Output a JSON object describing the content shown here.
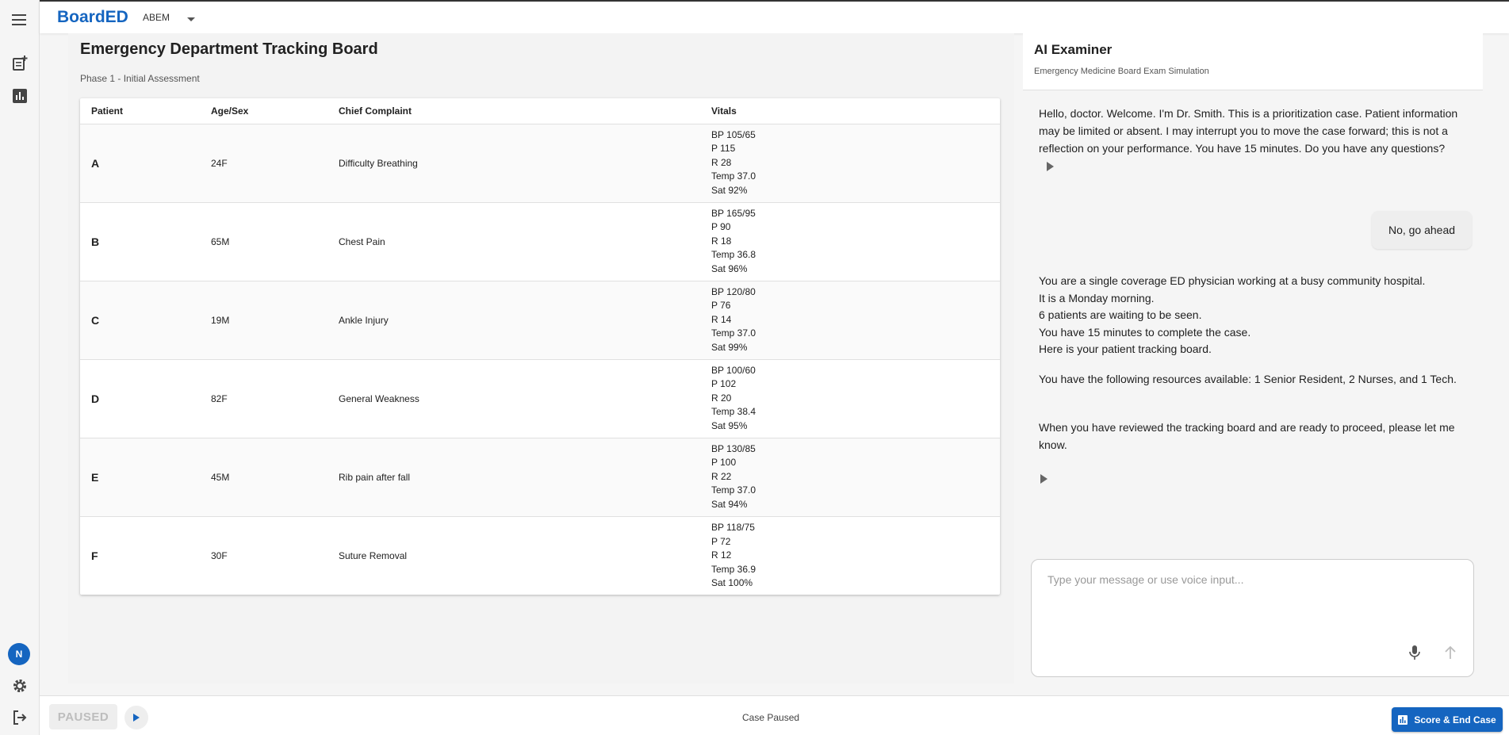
{
  "app": {
    "brand": "BoardED",
    "exam_selector": "ABEM"
  },
  "nav": {
    "icons": [
      "menu-icon",
      "new-case-icon",
      "analytics-icon",
      "settings-icon",
      "logout-icon"
    ],
    "avatar_initial": "N"
  },
  "main": {
    "title": "Emergency Department Tracking Board",
    "phase": "Phase 1 - Initial Assessment",
    "columns": [
      "Patient",
      "Age/Sex",
      "Chief Complaint",
      "Vitals"
    ],
    "patients": [
      {
        "id": "A",
        "age_sex": "24F",
        "complaint": "Difficulty Breathing",
        "bp": "BP 105/65",
        "p": "P 115",
        "r": "R 28",
        "temp": "Temp 37.0",
        "sat": "Sat 92%"
      },
      {
        "id": "B",
        "age_sex": "65M",
        "complaint": "Chest Pain",
        "bp": "BP 165/95",
        "p": "P 90",
        "r": "R 18",
        "temp": "Temp 36.8",
        "sat": "Sat 96%"
      },
      {
        "id": "C",
        "age_sex": "19M",
        "complaint": "Ankle Injury",
        "bp": "BP 120/80",
        "p": "P 76",
        "r": "R 14",
        "temp": "Temp 37.0",
        "sat": "Sat 99%"
      },
      {
        "id": "D",
        "age_sex": "82F",
        "complaint": "General Weakness",
        "bp": "BP 100/60",
        "p": "P 102",
        "r": "R 20",
        "temp": "Temp 38.4",
        "sat": "Sat 95%"
      },
      {
        "id": "E",
        "age_sex": "45M",
        "complaint": "Rib pain after fall",
        "bp": "BP 130/85",
        "p": "P 100",
        "r": "R 22",
        "temp": "Temp 37.0",
        "sat": "Sat 94%"
      },
      {
        "id": "F",
        "age_sex": "30F",
        "complaint": "Suture Removal",
        "bp": "BP 118/75",
        "p": "P 72",
        "r": "R 12",
        "temp": "Temp 36.9",
        "sat": "Sat 100%"
      }
    ]
  },
  "examiner": {
    "title": "AI Examiner",
    "subtitle": "Emergency Medicine Board Exam Simulation",
    "messages": {
      "intro": "Hello, doctor. Welcome. I'm Dr. Smith. This is a prioritization case. Patient information may be limited or absent. I may interrupt you to move the case forward; this is not a reflection on your performance. You have 15 minutes. Do you have any questions?",
      "user_reply": "No, go ahead",
      "scenario_lines": [
        "You are a single coverage ED physician working at a busy community hospital.",
        "It is a Monday morning.",
        "6 patients are waiting to be seen.",
        "You have 15 minutes to complete the case.",
        "Here is your patient tracking board."
      ],
      "resources": "You have the following resources available: 1 Senior Resident, 2 Nurses, and 1 Tech.",
      "proceed": "When you have reviewed the tracking board and are ready to proceed, please let me know."
    },
    "input": {
      "placeholder": "Type your message or use voice input...",
      "value": ""
    }
  },
  "footer": {
    "paused_label": "PAUSED",
    "status": "Case Paused",
    "score_button": "Score & End Case"
  },
  "colors": {
    "brand": "#1565c0",
    "accent_button": "#1565c0"
  }
}
